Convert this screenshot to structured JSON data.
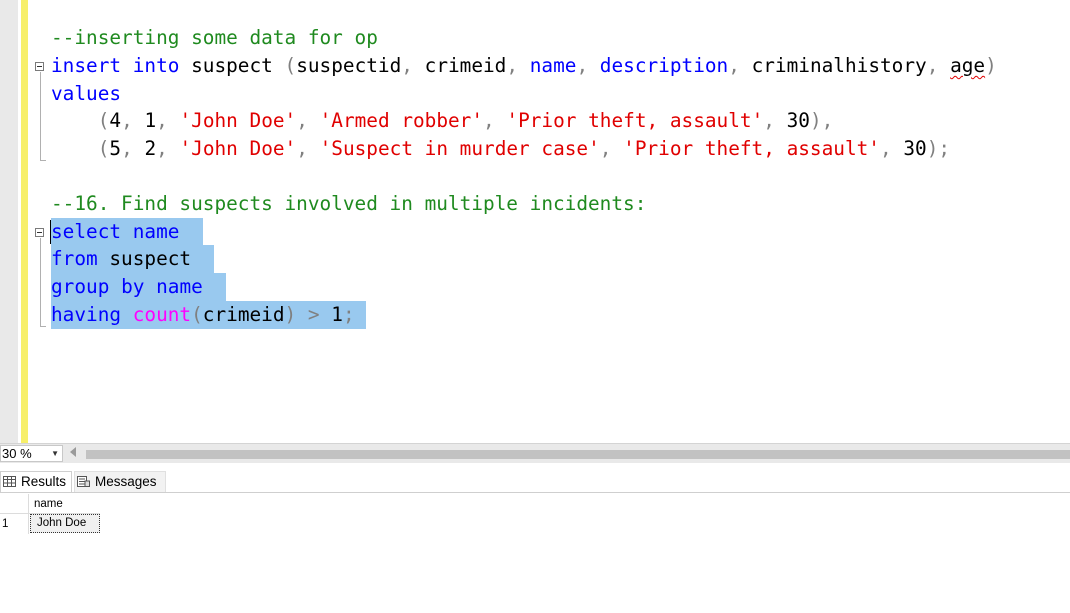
{
  "editor": {
    "lines": [
      {
        "id": "l1",
        "tokens": [
          {
            "t": "--inserting some data for op",
            "c": "cm"
          }
        ]
      },
      {
        "id": "l2",
        "tokens": [
          {
            "t": "insert",
            "c": "kw"
          },
          {
            "t": " ",
            "c": "id"
          },
          {
            "t": "into",
            "c": "kw"
          },
          {
            "t": " suspect ",
            "c": "id"
          },
          {
            "t": "(",
            "c": "gray"
          },
          {
            "t": "suspectid",
            "c": "id"
          },
          {
            "t": ", ",
            "c": "gray"
          },
          {
            "t": "crimeid",
            "c": "id"
          },
          {
            "t": ", ",
            "c": "gray"
          },
          {
            "t": "name",
            "c": "kw"
          },
          {
            "t": ", ",
            "c": "gray"
          },
          {
            "t": "description",
            "c": "kw"
          },
          {
            "t": ", ",
            "c": "gray"
          },
          {
            "t": "criminalhistory",
            "c": "id"
          },
          {
            "t": ", ",
            "c": "gray"
          },
          {
            "t": "age",
            "c": "id",
            "squiggle": true
          },
          {
            "t": ")",
            "c": "gray"
          }
        ]
      },
      {
        "id": "l3",
        "tokens": [
          {
            "t": "values",
            "c": "kw"
          }
        ]
      },
      {
        "id": "l4",
        "tokens": [
          {
            "t": "    ",
            "c": "id"
          },
          {
            "t": "(",
            "c": "gray"
          },
          {
            "t": "4",
            "c": "num"
          },
          {
            "t": ", ",
            "c": "gray"
          },
          {
            "t": "1",
            "c": "num"
          },
          {
            "t": ", ",
            "c": "gray"
          },
          {
            "t": "'John Doe'",
            "c": "str"
          },
          {
            "t": ", ",
            "c": "gray"
          },
          {
            "t": "'Armed robber'",
            "c": "str"
          },
          {
            "t": ", ",
            "c": "gray"
          },
          {
            "t": "'Prior theft, assault'",
            "c": "str"
          },
          {
            "t": ", ",
            "c": "gray"
          },
          {
            "t": "30",
            "c": "num"
          },
          {
            "t": "),",
            "c": "gray"
          }
        ]
      },
      {
        "id": "l5",
        "tokens": [
          {
            "t": "    ",
            "c": "id"
          },
          {
            "t": "(",
            "c": "gray"
          },
          {
            "t": "5",
            "c": "num"
          },
          {
            "t": ", ",
            "c": "gray"
          },
          {
            "t": "2",
            "c": "num"
          },
          {
            "t": ", ",
            "c": "gray"
          },
          {
            "t": "'John Doe'",
            "c": "str"
          },
          {
            "t": ", ",
            "c": "gray"
          },
          {
            "t": "'Suspect in murder case'",
            "c": "str"
          },
          {
            "t": ", ",
            "c": "gray"
          },
          {
            "t": "'Prior theft, assault'",
            "c": "str"
          },
          {
            "t": ", ",
            "c": "gray"
          },
          {
            "t": "30",
            "c": "num"
          },
          {
            "t": ");",
            "c": "gray"
          }
        ]
      },
      {
        "id": "l6",
        "tokens": [
          {
            "t": "--16. Find suspects involved in multiple incidents:",
            "c": "cm"
          }
        ]
      },
      {
        "id": "l7",
        "selected": true,
        "tokens": [
          {
            "t": "select",
            "c": "kw"
          },
          {
            "t": " ",
            "c": "id"
          },
          {
            "t": "name",
            "c": "kw"
          },
          {
            "t": "  ",
            "c": "id"
          }
        ]
      },
      {
        "id": "l8",
        "selected": true,
        "tokens": [
          {
            "t": "from",
            "c": "kw"
          },
          {
            "t": " suspect  ",
            "c": "id"
          }
        ]
      },
      {
        "id": "l9",
        "selected": true,
        "tokens": [
          {
            "t": "group",
            "c": "kw"
          },
          {
            "t": " ",
            "c": "id"
          },
          {
            "t": "by",
            "c": "kw"
          },
          {
            "t": " ",
            "c": "id"
          },
          {
            "t": "name",
            "c": "kw"
          },
          {
            "t": "  ",
            "c": "id"
          }
        ]
      },
      {
        "id": "l10",
        "selected": true,
        "tokens": [
          {
            "t": "having",
            "c": "kw"
          },
          {
            "t": " ",
            "c": "id"
          },
          {
            "t": "count",
            "c": "fn"
          },
          {
            "t": "(",
            "c": "gray"
          },
          {
            "t": "crimeid",
            "c": "id"
          },
          {
            "t": ")",
            "c": "gray"
          },
          {
            "t": " > ",
            "c": "gray"
          },
          {
            "t": "1",
            "c": "num"
          },
          {
            "t": ";",
            "c": "gray"
          },
          {
            "t": " ",
            "c": "id"
          }
        ]
      }
    ]
  },
  "statusbar": {
    "zoom": "30 %"
  },
  "results": {
    "tabs": [
      {
        "label": "Results"
      },
      {
        "label": "Messages"
      }
    ],
    "columns": [
      "name"
    ],
    "rows": [
      {
        "num": "1",
        "cells": [
          "John Doe"
        ]
      }
    ]
  },
  "colors": {
    "comment": "#1f8a1f",
    "keyword": "#0000ff",
    "string": "#e00000",
    "function": "#ff00ff",
    "operator": "#808080",
    "selection": "#99c9ef",
    "change_bar": "#f7ef6a"
  }
}
